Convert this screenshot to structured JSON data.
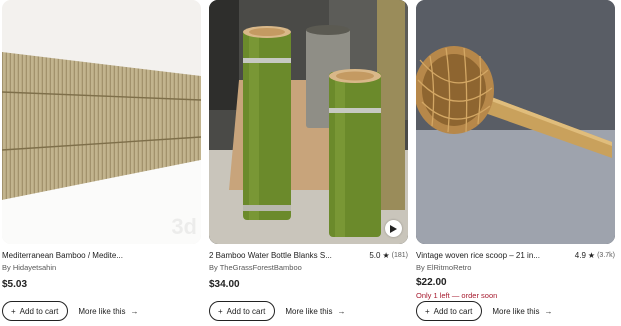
{
  "listings": [
    {
      "title": "Mediterranean Bamboo / Medite...",
      "seller": "By Hidayetsahin",
      "price": "$5.03",
      "rating": null,
      "rating_count": null,
      "stock_note": "",
      "add_to_cart": "Add to cart",
      "more_like_this": "More like this",
      "image_icon": "bamboo-fence-image",
      "watermark": "3d"
    },
    {
      "title": "2 Bamboo Water Bottle Blanks S...",
      "seller": "By TheGrassForestBamboo",
      "price": "$34.00",
      "rating": "5.0",
      "rating_count": "(181)",
      "stock_note": "",
      "add_to_cart": "Add to cart",
      "more_like_this": "More like this",
      "image_icon": "bamboo-bottles-image",
      "has_video": true
    },
    {
      "title": "Vintage woven rice scoop – 21 in...",
      "seller": "By ElRitmoRetro",
      "price": "$22.00",
      "rating": "4.9",
      "rating_count": "(3.7k)",
      "stock_note": "Only 1 left — order soon",
      "add_to_cart": "Add to cart",
      "more_like_this": "More like this",
      "image_icon": "rice-scoop-image"
    }
  ],
  "colors": {
    "stock_warning": "#a61a2e",
    "text": "#222222",
    "muted": "#595959"
  }
}
